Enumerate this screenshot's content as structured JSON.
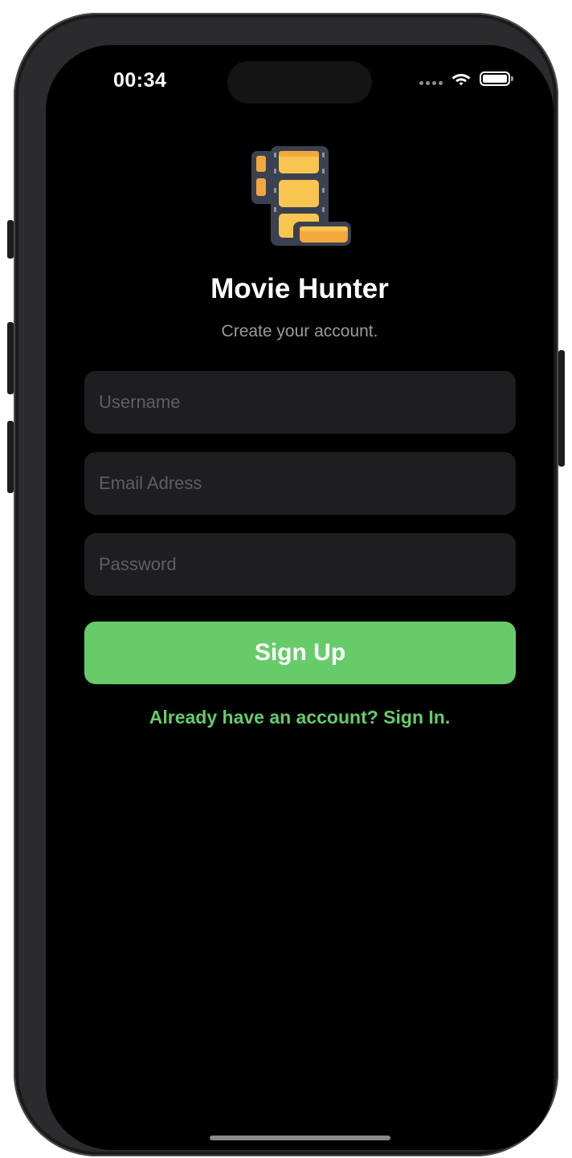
{
  "status_bar": {
    "time": "00:34",
    "wifi_icon": "wifi-icon",
    "battery_icon": "battery-icon",
    "signal_icon": "cellular-signal-icon"
  },
  "app": {
    "logo_icon": "film-reel-icon",
    "title": "Movie Hunter",
    "subtitle": "Create your account."
  },
  "form": {
    "username": {
      "value": "",
      "placeholder": "Username"
    },
    "email": {
      "value": "",
      "placeholder": "Email Adress"
    },
    "password": {
      "value": "",
      "placeholder": "Password"
    },
    "submit_label": "Sign Up"
  },
  "footer": {
    "signin_link": "Already have an account? Sign In."
  },
  "colors": {
    "accent": "#66cc6a",
    "background": "#000000",
    "field_background": "#1e1e20",
    "logo_yellow": "#f8c550",
    "logo_orange": "#f2a83c",
    "logo_frame": "#3a4150"
  }
}
